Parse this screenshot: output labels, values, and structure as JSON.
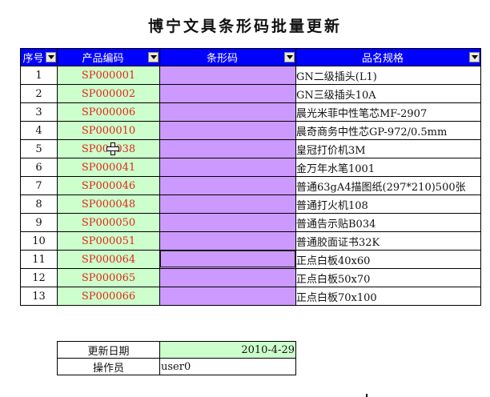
{
  "title": "博宁文具条形码批量更新",
  "headers": {
    "seq": "序号",
    "code": "产品编码",
    "barcode": "条形码",
    "name": "品名规格"
  },
  "rows": [
    {
      "seq": "1",
      "code": "SP000001",
      "barcode": "",
      "name": "GN二级插头(L1)"
    },
    {
      "seq": "2",
      "code": "SP000002",
      "barcode": "",
      "name": "GN三级插头10A"
    },
    {
      "seq": "3",
      "code": "SP000006",
      "barcode": "",
      "name": "晨光米菲中性笔芯MF-2907"
    },
    {
      "seq": "4",
      "code": "SP000010",
      "barcode": "",
      "name": "晨奇商务中性芯GP-972/0.5mm"
    },
    {
      "seq": "5",
      "code": "SP000038",
      "barcode": "",
      "name": "皇冠打价机3M"
    },
    {
      "seq": "6",
      "code": "SP000041",
      "barcode": "",
      "name": "金万年水笔1001"
    },
    {
      "seq": "7",
      "code": "SP000046",
      "barcode": "",
      "name": "普通63gA4描图纸(297*210)500张"
    },
    {
      "seq": "8",
      "code": "SP000048",
      "barcode": "",
      "name": "普通打火机108"
    },
    {
      "seq": "9",
      "code": "SP000050",
      "barcode": "",
      "name": "普通告示贴B034"
    },
    {
      "seq": "10",
      "code": "SP000051",
      "barcode": "",
      "name": "普通胶面证书32K"
    },
    {
      "seq": "11",
      "code": "SP000064",
      "barcode": "",
      "name": "正点白板40x60"
    },
    {
      "seq": "12",
      "code": "SP000065",
      "barcode": "",
      "name": "正点白板50x70"
    },
    {
      "seq": "13",
      "code": "SP000066",
      "barcode": "",
      "name": "正点白板70x100"
    }
  ],
  "info": {
    "update_date_label": "更新日期",
    "update_date_value": "2010-4-29",
    "operator_label": "操作员",
    "operator_value": "user0"
  },
  "colors": {
    "header_bg": "#0000ff",
    "code_bg": "#ccffcc",
    "code_text": "#e0281a",
    "barcode_bg": "#cc99ff"
  }
}
